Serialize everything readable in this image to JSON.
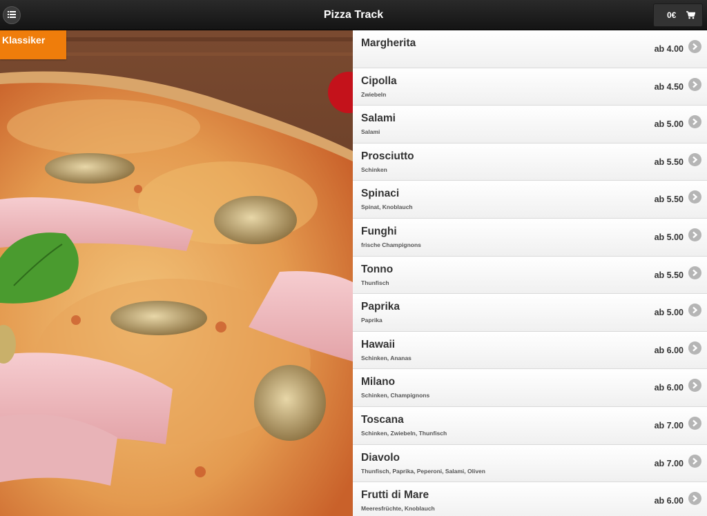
{
  "header": {
    "title": "Pizza Track",
    "menu_icon": "list-icon",
    "cart_total": "0€",
    "cart_icon": "shopping-cart-icon"
  },
  "category": {
    "label": "Klassiker"
  },
  "hero": {
    "image": "pizza-photo"
  },
  "colors": {
    "accent": "#ef7d0b",
    "header_bg": "#1c1c1c",
    "list_bg": "#f7f7f7"
  },
  "items": [
    {
      "name": "Margherita",
      "desc": "",
      "price": "ab 4.00"
    },
    {
      "name": "Cipolla",
      "desc": "Zwiebeln",
      "price": "ab 4.50"
    },
    {
      "name": "Salami",
      "desc": "Salami",
      "price": "ab 5.00"
    },
    {
      "name": "Prosciutto",
      "desc": "Schinken",
      "price": "ab 5.50"
    },
    {
      "name": "Spinaci",
      "desc": "Spinat, Knoblauch",
      "price": "ab 5.50"
    },
    {
      "name": "Funghi",
      "desc": "frische Champignons",
      "price": "ab 5.00"
    },
    {
      "name": "Tonno",
      "desc": "Thunfisch",
      "price": "ab 5.50"
    },
    {
      "name": "Paprika",
      "desc": "Paprika",
      "price": "ab 5.00"
    },
    {
      "name": "Hawaii",
      "desc": "Schinken, Ananas",
      "price": "ab 6.00"
    },
    {
      "name": "Milano",
      "desc": "Schinken, Champignons",
      "price": "ab 6.00"
    },
    {
      "name": "Toscana",
      "desc": "Schinken, Zwiebeln, Thunfisch",
      "price": "ab 7.00"
    },
    {
      "name": "Diavolo",
      "desc": "Thunfisch, Paprika, Peperoni, Salami, Oliven",
      "price": "ab 7.00"
    },
    {
      "name": "Frutti di Mare",
      "desc": "Meeresfrüchte, Knoblauch",
      "price": "ab 6.00"
    }
  ]
}
